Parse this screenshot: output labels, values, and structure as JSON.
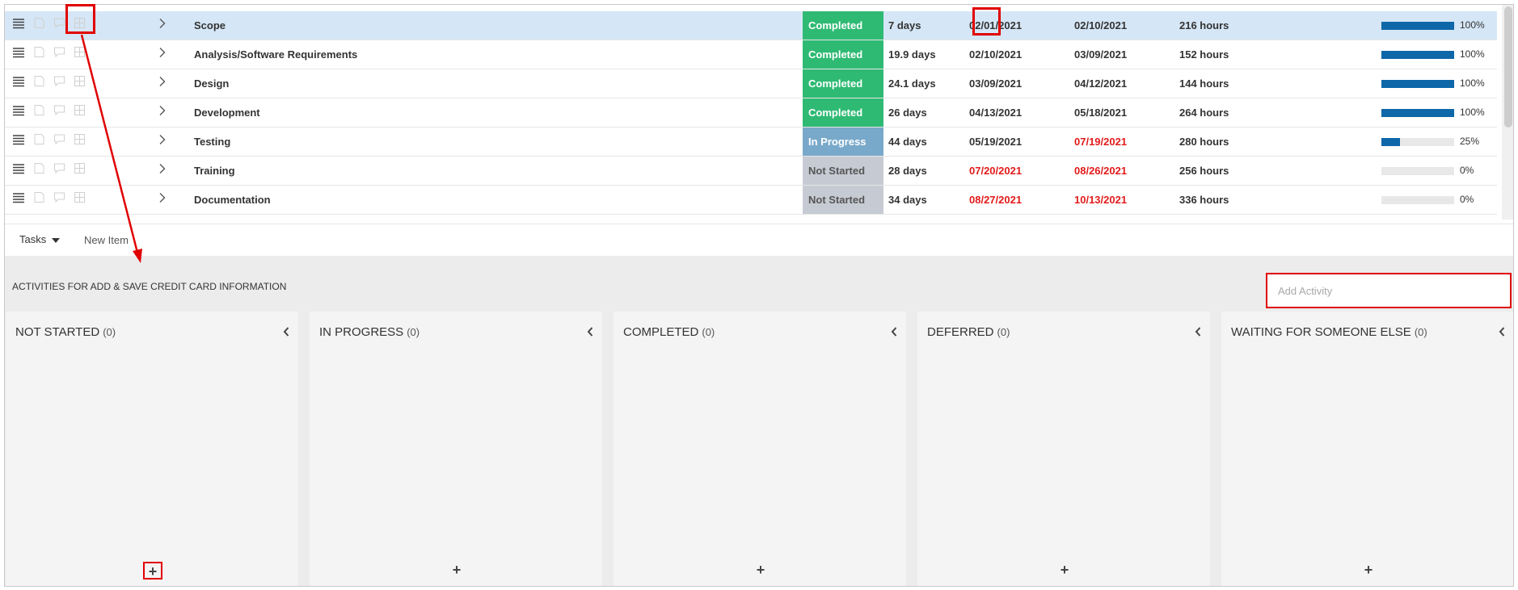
{
  "tasks": [
    {
      "name": "Scope",
      "status": "Completed",
      "status_type": "completed",
      "duration": "7 days",
      "start": "02/01/2021",
      "start_late": false,
      "end": "02/10/2021",
      "end_late": false,
      "work": "216 hours",
      "progress": 100,
      "progress_label": "100%",
      "selected": true
    },
    {
      "name": "Analysis/Software Requirements",
      "status": "Completed",
      "status_type": "completed",
      "duration": "19.9 days",
      "start": "02/10/2021",
      "start_late": false,
      "end": "03/09/2021",
      "end_late": false,
      "work": "152 hours",
      "progress": 100,
      "progress_label": "100%",
      "selected": false
    },
    {
      "name": "Design",
      "status": "Completed",
      "status_type": "completed",
      "duration": "24.1 days",
      "start": "03/09/2021",
      "start_late": false,
      "end": "04/12/2021",
      "end_late": false,
      "work": "144 hours",
      "progress": 100,
      "progress_label": "100%",
      "selected": false
    },
    {
      "name": "Development",
      "status": "Completed",
      "status_type": "completed",
      "duration": "26 days",
      "start": "04/13/2021",
      "start_late": false,
      "end": "05/18/2021",
      "end_late": false,
      "work": "264 hours",
      "progress": 100,
      "progress_label": "100%",
      "selected": false
    },
    {
      "name": "Testing",
      "status": "In Progress",
      "status_type": "inprogress",
      "duration": "44 days",
      "start": "05/19/2021",
      "start_late": false,
      "end": "07/19/2021",
      "end_late": true,
      "work": "280 hours",
      "progress": 25,
      "progress_label": "25%",
      "selected": false
    },
    {
      "name": "Training",
      "status": "Not Started",
      "status_type": "notstarted",
      "duration": "28 days",
      "start": "07/20/2021",
      "start_late": true,
      "end": "08/26/2021",
      "end_late": true,
      "work": "256 hours",
      "progress": 0,
      "progress_label": "0%",
      "selected": false
    },
    {
      "name": "Documentation",
      "status": "Not Started",
      "status_type": "notstarted",
      "duration": "34 days",
      "start": "08/27/2021",
      "start_late": true,
      "end": "10/13/2021",
      "end_late": true,
      "work": "336 hours",
      "progress": 0,
      "progress_label": "0%",
      "selected": false
    }
  ],
  "toolbar": {
    "tasks_label": "Tasks",
    "new_item_label": "New Item"
  },
  "activities": {
    "title": "ACTIVITIES FOR ADD & SAVE CREDIT CARD INFORMATION",
    "add_placeholder": "Add Activity",
    "lanes": [
      {
        "title": "NOT STARTED",
        "count": "(0)",
        "add_icon": "plus-icon"
      },
      {
        "title": "IN PROGRESS",
        "count": "(0)",
        "add_icon": "plus-icon"
      },
      {
        "title": "COMPLETED",
        "count": "(0)",
        "add_icon": "plus-icon"
      },
      {
        "title": "DEFERRED",
        "count": "(0)",
        "add_icon": "plus-icon"
      },
      {
        "title": "WAITING FOR SOMEONE ELSE",
        "count": "(0)",
        "add_icon": "plus-icon"
      }
    ],
    "plus_symbol": "+"
  },
  "colors": {
    "completed": "#2fba74",
    "in_progress": "#79a9ca",
    "not_started": "#c6cbd3",
    "progress_fill": "#0e67a8",
    "late_date": "#e21b1b",
    "annotation": "#e00000",
    "selected_row": "#d5e6f6"
  }
}
